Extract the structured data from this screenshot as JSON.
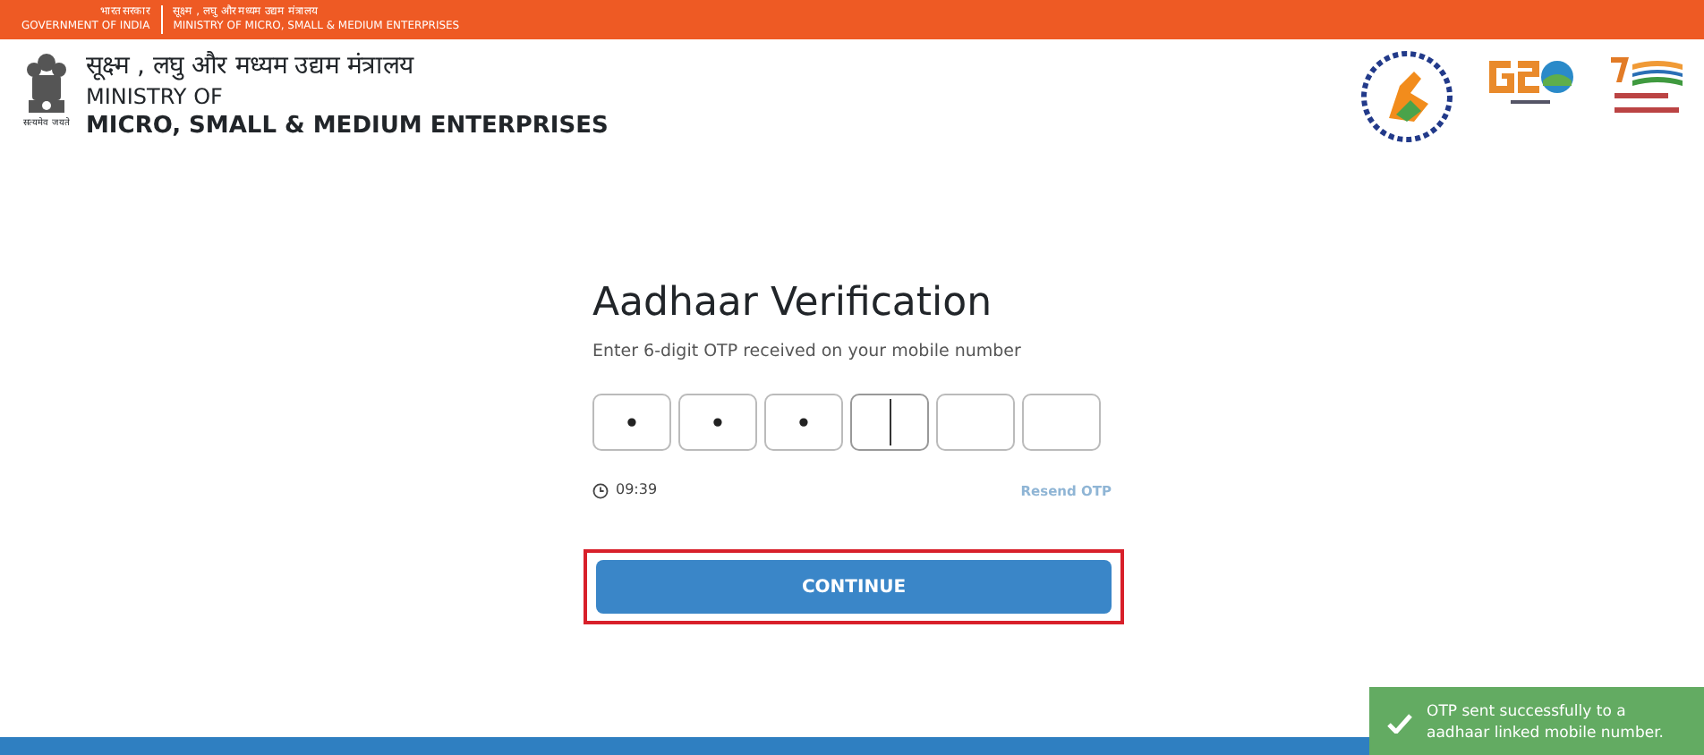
{
  "top_bar": {
    "govt_hindi": "भारत सरकार",
    "govt_english": "GOVERNMENT OF INDIA",
    "ministry_hindi": "सूक्ष्म , लघु और मध्यम उद्यम मंत्रालय",
    "ministry_english": "MINISTRY OF MICRO, SMALL & MEDIUM ENTERPRISES"
  },
  "header": {
    "emblem_caption": "सत्यमेव जयते",
    "title_hindi": "सूक्ष्म , लघु और मध्यम उद्यम मंत्रालय",
    "title_line1": "MINISTRY OF",
    "title_line2": "MICRO, SMALL & MEDIUM ENTERPRISES"
  },
  "verification": {
    "title": "Aadhaar Verification",
    "subtitle": "Enter 6-digit OTP received on your mobile number",
    "otp_boxes": [
      {
        "value": "•",
        "focused": false
      },
      {
        "value": "•",
        "focused": false
      },
      {
        "value": "•",
        "focused": false
      },
      {
        "focused": true
      },
      {
        "focused": false
      },
      {
        "focused": false
      }
    ],
    "timer": "09:39",
    "resend": "Resend OTP",
    "continue": "CONTINUE",
    "continue_highlighted": true
  },
  "toast": {
    "message": "OTP sent successfully to a aadhaar linked mobile number."
  }
}
